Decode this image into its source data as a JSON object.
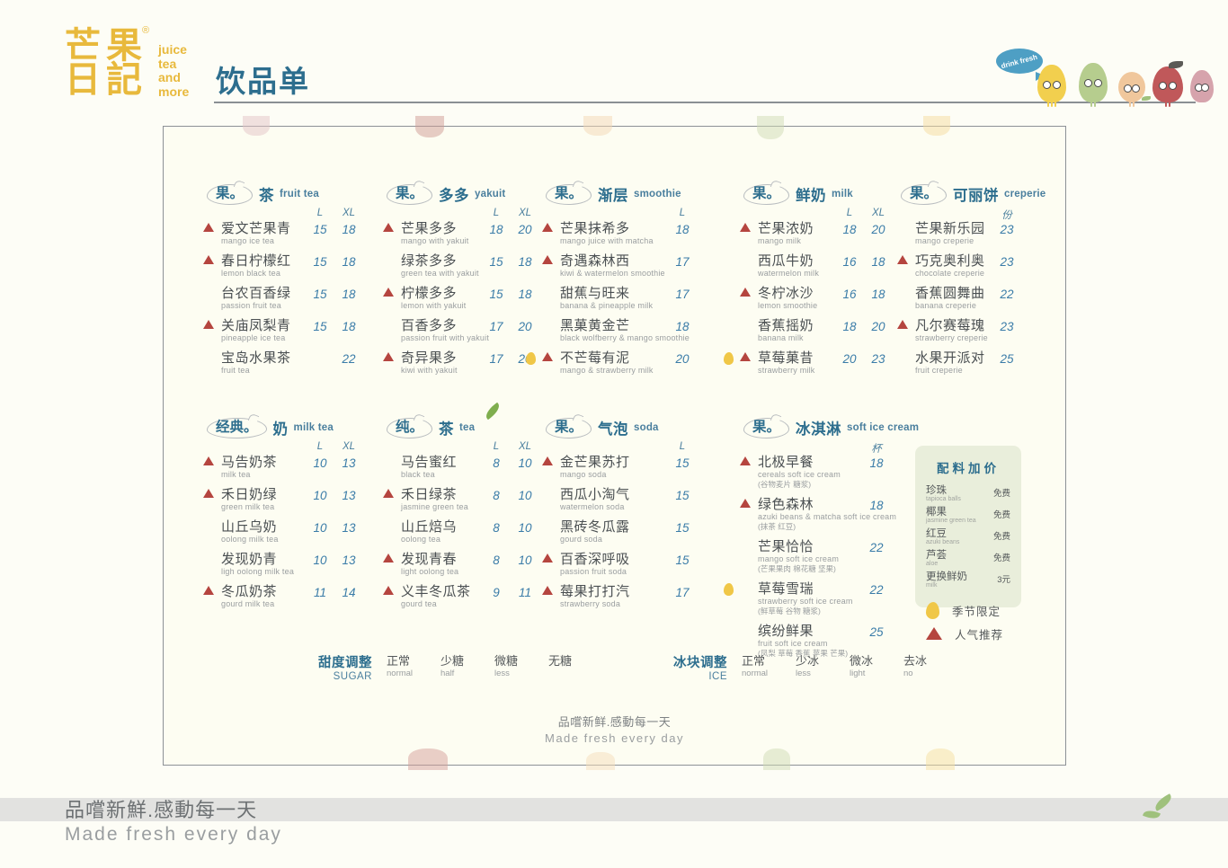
{
  "brand": {
    "logo_chars": [
      "芒",
      "果",
      "日",
      "記"
    ],
    "registered": "®",
    "tagline_lines": [
      "juice",
      "tea",
      "and",
      "more"
    ],
    "accent_color": "#e8b93c"
  },
  "header": {
    "title": "饮品单",
    "mascot_bubble": "drink fresh"
  },
  "menu": {
    "sections": [
      {
        "bubble": "果。",
        "name": "茶",
        "en": "fruit tea",
        "sizes": [
          "L",
          "XL"
        ],
        "items": [
          {
            "cn": "爱文芒果青",
            "en": "mango ice tea",
            "prices": [
              "15",
              "18"
            ],
            "hot": true,
            "seasonal": false
          },
          {
            "cn": "春日柠檬红",
            "en": "lemon black tea",
            "prices": [
              "15",
              "18"
            ],
            "hot": true,
            "seasonal": false
          },
          {
            "cn": "台农百香绿",
            "en": "passion fruit tea",
            "prices": [
              "15",
              "18"
            ],
            "hot": false,
            "seasonal": false
          },
          {
            "cn": "关庙凤梨青",
            "en": "pineapple ice tea",
            "prices": [
              "15",
              "18"
            ],
            "hot": true,
            "seasonal": false
          },
          {
            "cn": "宝岛水果茶",
            "en": "fruit tea",
            "prices": [
              "",
              "22"
            ],
            "hot": false,
            "seasonal": false
          }
        ]
      },
      {
        "bubble": "果。",
        "name": "多多",
        "en": "yakuit",
        "sizes": [
          "L",
          "XL"
        ],
        "items": [
          {
            "cn": "芒果多多",
            "en": "mango with yakuit",
            "prices": [
              "18",
              "20"
            ],
            "hot": true,
            "seasonal": false
          },
          {
            "cn": "绿茶多多",
            "en": "green tea with yakuit",
            "prices": [
              "15",
              "18"
            ],
            "hot": false,
            "seasonal": false
          },
          {
            "cn": "柠檬多多",
            "en": "lemon with yakuit",
            "prices": [
              "15",
              "18"
            ],
            "hot": true,
            "seasonal": false
          },
          {
            "cn": "百香多多",
            "en": "passion fruit with yakuit",
            "prices": [
              "17",
              "20"
            ],
            "hot": false,
            "seasonal": false
          },
          {
            "cn": "奇异果多",
            "en": "kiwi with yakuit",
            "prices": [
              "17",
              "20"
            ],
            "hot": true,
            "seasonal": false
          }
        ]
      },
      {
        "bubble": "果。",
        "name": "渐层",
        "en": "smoothie",
        "sizes": [
          "L"
        ],
        "items": [
          {
            "cn": "芒果抹希多",
            "en": "mango juice with matcha",
            "prices": [
              "18"
            ],
            "hot": true,
            "seasonal": false
          },
          {
            "cn": "奇遇森林西",
            "en": "kiwi & watermelon smoothie",
            "prices": [
              "17"
            ],
            "hot": true,
            "seasonal": false
          },
          {
            "cn": "甜蕉与旺来",
            "en": "banana & pineapple milk",
            "prices": [
              "17"
            ],
            "hot": false,
            "seasonal": false
          },
          {
            "cn": "黑菓黄金芒",
            "en": "black wolfberry & mango smoothie",
            "prices": [
              "18"
            ],
            "hot": false,
            "seasonal": false
          },
          {
            "cn": "不芒莓有泥",
            "en": "mango & strawberry milk",
            "prices": [
              "20"
            ],
            "hot": true,
            "seasonal": true
          }
        ]
      },
      {
        "bubble": "果。",
        "name": "鲜奶",
        "en": "milk",
        "sizes": [
          "L",
          "XL"
        ],
        "items": [
          {
            "cn": "芒果浓奶",
            "en": "mango milk",
            "prices": [
              "18",
              "20"
            ],
            "hot": true,
            "seasonal": false
          },
          {
            "cn": "西瓜牛奶",
            "en": "watermelon milk",
            "prices": [
              "16",
              "18"
            ],
            "hot": false,
            "seasonal": false
          },
          {
            "cn": "冬柠冰沙",
            "en": "lemon smoothie",
            "prices": [
              "16",
              "18"
            ],
            "hot": true,
            "seasonal": false
          },
          {
            "cn": "香蕉摇奶",
            "en": "banana milk",
            "prices": [
              "18",
              "20"
            ],
            "hot": false,
            "seasonal": false
          },
          {
            "cn": "草莓菓昔",
            "en": "strawberry milk",
            "prices": [
              "20",
              "23"
            ],
            "hot": true,
            "seasonal": true
          }
        ]
      },
      {
        "bubble": "果。",
        "name": "可丽饼",
        "en": "creperie",
        "sizes": [
          "份"
        ],
        "items": [
          {
            "cn": "芒果新乐园",
            "en": "mango creperie",
            "prices": [
              "23"
            ],
            "hot": false,
            "seasonal": false
          },
          {
            "cn": "巧克奥利奥",
            "en": "chocolate creperie",
            "prices": [
              "23"
            ],
            "hot": true,
            "seasonal": false
          },
          {
            "cn": "香蕉圆舞曲",
            "en": "banana creperie",
            "prices": [
              "22"
            ],
            "hot": false,
            "seasonal": false
          },
          {
            "cn": "凡尔赛莓瑰",
            "en": "strawberry creperie",
            "prices": [
              "23"
            ],
            "hot": true,
            "seasonal": false
          },
          {
            "cn": "水果开派对",
            "en": "fruit creperie",
            "prices": [
              "25"
            ],
            "hot": false,
            "seasonal": false
          }
        ]
      },
      {
        "bubble": "经典。",
        "name": "奶",
        "en": "milk tea",
        "sizes": [
          "L",
          "XL"
        ],
        "items": [
          {
            "cn": "马告奶茶",
            "en": "milk tea",
            "prices": [
              "10",
              "13"
            ],
            "hot": true,
            "seasonal": false
          },
          {
            "cn": "禾日奶绿",
            "en": "green milk tea",
            "prices": [
              "10",
              "13"
            ],
            "hot": true,
            "seasonal": false
          },
          {
            "cn": "山丘乌奶",
            "en": "oolong milk tea",
            "prices": [
              "10",
              "13"
            ],
            "hot": false,
            "seasonal": false
          },
          {
            "cn": "发现奶青",
            "en": "ligh oolong milk tea",
            "prices": [
              "10",
              "13"
            ],
            "hot": false,
            "seasonal": false
          },
          {
            "cn": "冬瓜奶茶",
            "en": "gourd  milk tea",
            "prices": [
              "11",
              "14"
            ],
            "hot": true,
            "seasonal": false
          }
        ]
      },
      {
        "bubble": "纯。",
        "name": "茶",
        "en": "tea",
        "sizes": [
          "L",
          "XL"
        ],
        "items": [
          {
            "cn": "马告蜜红",
            "en": "black tea",
            "prices": [
              "8",
              "10"
            ],
            "hot": false,
            "seasonal": false
          },
          {
            "cn": "禾日绿茶",
            "en": "jasmine green tea",
            "prices": [
              "8",
              "10"
            ],
            "hot": true,
            "seasonal": false
          },
          {
            "cn": "山丘焙乌",
            "en": "oolong tea",
            "prices": [
              "8",
              "10"
            ],
            "hot": false,
            "seasonal": false
          },
          {
            "cn": "发现青春",
            "en": "light oolong tea",
            "prices": [
              "8",
              "10"
            ],
            "hot": true,
            "seasonal": false
          },
          {
            "cn": "义丰冬瓜茶",
            "en": "gourd tea",
            "prices": [
              "9",
              "11"
            ],
            "hot": true,
            "seasonal": false
          }
        ]
      },
      {
        "bubble": "果。",
        "name": "气泡",
        "en": "soda",
        "sizes": [
          "L"
        ],
        "items": [
          {
            "cn": "金芒果苏打",
            "en": "mango soda",
            "prices": [
              "15"
            ],
            "hot": true,
            "seasonal": false
          },
          {
            "cn": "西瓜小淘气",
            "en": "watermelon soda",
            "prices": [
              "15"
            ],
            "hot": false,
            "seasonal": false
          },
          {
            "cn": "黑砖冬瓜露",
            "en": "gourd soda",
            "prices": [
              "15"
            ],
            "hot": false,
            "seasonal": false
          },
          {
            "cn": "百香深呼吸",
            "en": "passion fruit soda",
            "prices": [
              "15"
            ],
            "hot": true,
            "seasonal": false
          },
          {
            "cn": "莓果打打汽",
            "en": "strawberry soda",
            "prices": [
              "17"
            ],
            "hot": true,
            "seasonal": false
          }
        ]
      },
      {
        "bubble": "果。",
        "name": "冰淇淋",
        "en": "soft ice cream",
        "sizes": [
          "杯"
        ],
        "items": [
          {
            "cn": "北极早餐",
            "en": "cereals soft ice cream",
            "note": "(谷物麦片 糖浆)",
            "prices": [
              "18"
            ],
            "hot": true,
            "seasonal": false
          },
          {
            "cn": "绿色森林",
            "en": "azuki beans & matcha soft ice cream",
            "note": "(抹茶 红豆)",
            "prices": [
              "18"
            ],
            "hot": true,
            "seasonal": false
          },
          {
            "cn": "芒果恰恰",
            "en": "mango soft ice cream",
            "note": "(芒果果肉 棉花糖 坚果)",
            "prices": [
              "22"
            ],
            "hot": false,
            "seasonal": false
          },
          {
            "cn": "草莓雪瑞",
            "en": "strawberry soft ice cream",
            "note": "(鲜草莓 谷物 糖浆)",
            "prices": [
              "22"
            ],
            "hot": false,
            "seasonal": true
          },
          {
            "cn": "缤纷鲜果",
            "en": "fruit soft ice cream",
            "note": "(凤梨 草莓 香蕉 苹果 芒果)",
            "prices": [
              "25"
            ],
            "hot": false,
            "seasonal": false
          }
        ]
      }
    ]
  },
  "toppings": {
    "title": "配料加价",
    "items": [
      {
        "cn": "珍珠",
        "en": "tapioca balls",
        "price": "免费"
      },
      {
        "cn": "椰果",
        "en": "jasmine green tea",
        "price": "免费"
      },
      {
        "cn": "红豆",
        "en": "azuki beans",
        "price": "免费"
      },
      {
        "cn": "芦荟",
        "en": "aloe",
        "price": "免费"
      },
      {
        "cn": "更换鲜奶",
        "en": "milk",
        "price": "3元"
      }
    ],
    "legend": [
      {
        "icon": "seed-icon",
        "label": "季节限定"
      },
      {
        "icon": "triangle-icon",
        "label": "人气推荐"
      }
    ]
  },
  "options": {
    "sugar": {
      "cn": "甜度调整",
      "en": "SUGAR",
      "choices": [
        {
          "cn": "正常",
          "en": "normal"
        },
        {
          "cn": "少糖",
          "en": "half"
        },
        {
          "cn": "微糖",
          "en": "less"
        },
        {
          "cn": "无糖",
          "en": ""
        }
      ]
    },
    "ice": {
      "cn": "冰块调整",
      "en": "ICE",
      "choices": [
        {
          "cn": "正常",
          "en": "normal"
        },
        {
          "cn": "少冰",
          "en": "less"
        },
        {
          "cn": "微冰",
          "en": "light"
        },
        {
          "cn": "去冰",
          "en": "no"
        }
      ]
    }
  },
  "footer": {
    "cn": "品嚐新鲜.感動每一天",
    "en": "Made fresh every day"
  },
  "bottom_banner": {
    "cn": "品嚐新鮮.感動每一天",
    "en": "Made fresh every day"
  }
}
